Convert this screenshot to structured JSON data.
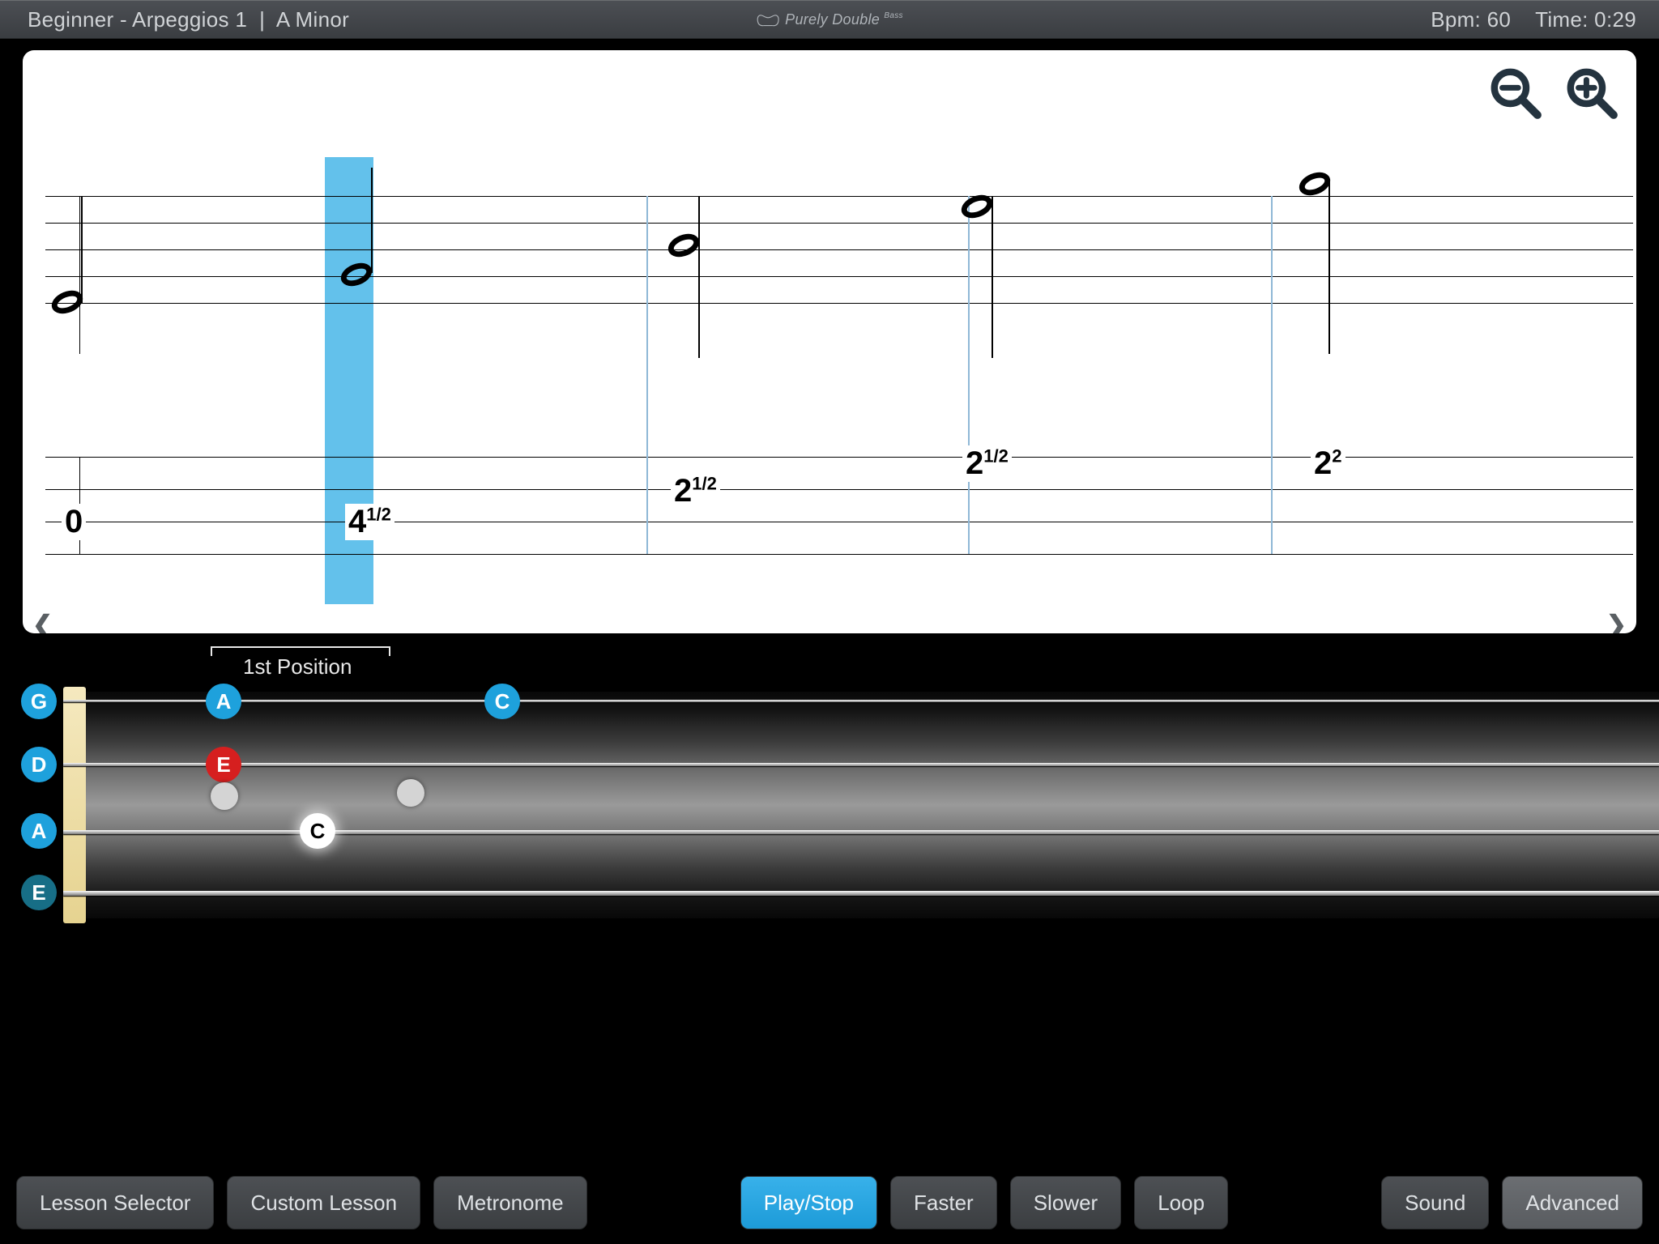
{
  "header": {
    "title": "Beginner - Arpeggios 1  |  A Minor",
    "brand": "Purely Double",
    "brand_sub": "Bass",
    "bpm_label": "Bpm: 60",
    "time_label": "Time: 0:29"
  },
  "score": {
    "tab_values": [
      "0",
      "4",
      "2",
      "2",
      "2"
    ],
    "tab_sups": [
      "",
      "1/2",
      "1/2",
      "1/2",
      "2"
    ],
    "nav_prev": "❮",
    "nav_next": "❯"
  },
  "fretboard": {
    "position_label": "1st Position",
    "open_strings": [
      "G",
      "D",
      "A",
      "E"
    ],
    "markers": {
      "g_A": "A",
      "g_C": "C",
      "d_E": "E",
      "a_C": "C"
    }
  },
  "toolbar": {
    "lesson_selector": "Lesson Selector",
    "custom_lesson": "Custom Lesson",
    "metronome": "Metronome",
    "play_stop": "Play/Stop",
    "faster": "Faster",
    "slower": "Slower",
    "loop": "Loop",
    "sound": "Sound",
    "advanced": "Advanced"
  }
}
